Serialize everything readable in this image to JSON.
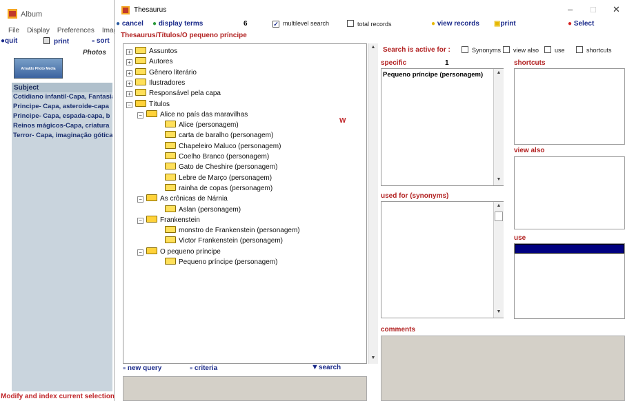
{
  "album": {
    "title": "Album",
    "menu": [
      "File",
      "Display",
      "Preferences",
      "Image"
    ],
    "tools": {
      "quit": "quit",
      "print": "print",
      "sort": "sort"
    },
    "photos_label": "Photos",
    "logo_text": "Arnaldo Photo Media",
    "subject_header": "Subject",
    "subjects": [
      "Cotidiano infantil-Capa, Fantasia",
      "Principe- Capa, asteroide-capa",
      "Principe- Capa, espada-capa, b",
      "Reinos mágicos-Capa, criatura",
      "Terror- Capa, imaginação gótica"
    ],
    "status": "Modify and index current selection"
  },
  "thesaurus": {
    "title": "Thesaurus",
    "window_controls": {
      "minimize": "–",
      "maximize": "□",
      "close": "✕"
    },
    "toolbar": {
      "cancel": "cancel",
      "display_terms": "display terms",
      "count": "6",
      "multilevel": "multilevel search",
      "multilevel_checked": "✓",
      "total_records": "total records",
      "view_records": "view records",
      "print": "print",
      "select": "Select"
    },
    "path": "Thesaurus/Títulos/O pequeno príncipe",
    "tree": [
      {
        "label": "Assuntos",
        "level": 0,
        "open": false
      },
      {
        "label": "Autores",
        "level": 0,
        "open": false
      },
      {
        "label": "Gênero literário",
        "level": 0,
        "open": false
      },
      {
        "label": "Ilustradores",
        "level": 0,
        "open": false
      },
      {
        "label": "Responsável pela capa",
        "level": 0,
        "open": false
      },
      {
        "label": "Títulos",
        "level": 0,
        "open": true
      },
      {
        "label": "Alice no país das maravilhas",
        "level": 1,
        "open": true
      },
      {
        "label": "Alice (personagem)",
        "level": 2,
        "leaf": true
      },
      {
        "label": "carta de baralho (personagem)",
        "level": 2,
        "leaf": true
      },
      {
        "label": "Chapeleiro Maluco (personagem)",
        "level": 2,
        "leaf": true
      },
      {
        "label": "Coelho Branco (personagem)",
        "level": 2,
        "leaf": true
      },
      {
        "label": "Gato de Cheshire (personagem)",
        "level": 2,
        "leaf": true
      },
      {
        "label": "Lebre de Março (personagem)",
        "level": 2,
        "leaf": true
      },
      {
        "label": "rainha de copas (personagem)",
        "level": 2,
        "leaf": true
      },
      {
        "label": "As crônicas de Nárnia",
        "level": 1,
        "open": true
      },
      {
        "label": "Aslan (personagem)",
        "level": 2,
        "leaf": true
      },
      {
        "label": "Frankenstein",
        "level": 1,
        "open": true
      },
      {
        "label": "monstro de Frankenstein (personagem)",
        "level": 2,
        "leaf": true
      },
      {
        "label": "Victor Frankenstein (personagem)",
        "level": 2,
        "leaf": true
      },
      {
        "label": "O pequeno príncipe",
        "level": 1,
        "open": true
      },
      {
        "label": "Pequeno príncipe (personagem)",
        "level": 2,
        "leaf": true
      }
    ],
    "w_marker": "W",
    "search_active": "Search is active for :",
    "filters": [
      "Synonyms",
      "view also",
      "use",
      "shortcuts"
    ],
    "specific_label": "specific",
    "specific_count": "1",
    "specific_items": [
      "Pequeno príncipe (personagem)"
    ],
    "shortcuts_label": "shortcuts",
    "view_also_label": "view also",
    "used_for_label": "used for (synonyms)",
    "use_label": "use",
    "comments_label": "comments",
    "bottom": {
      "new_query": "new query",
      "criteria": "criteria",
      "search": "search"
    }
  }
}
